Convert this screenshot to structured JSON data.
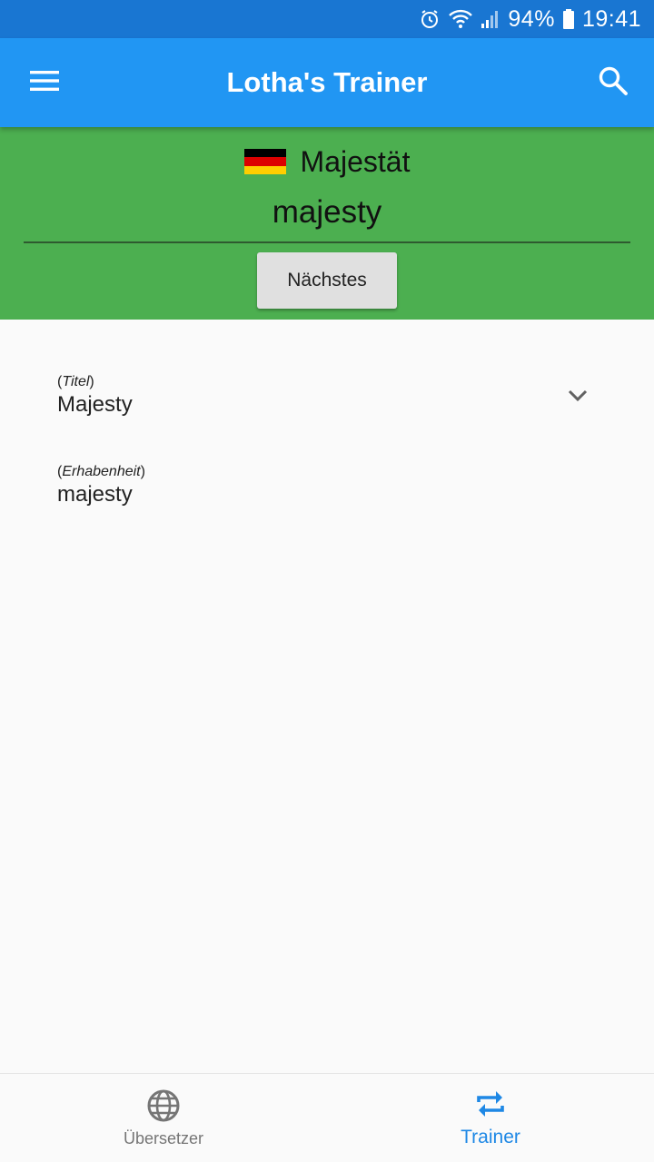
{
  "status_bar": {
    "battery": "94%",
    "time": "19:41",
    "icons": [
      "alarm-icon",
      "wifi-icon",
      "signal-icon",
      "battery-icon"
    ]
  },
  "app_bar": {
    "title": "Lotha's Trainer",
    "menu_icon": "menu-icon",
    "search_icon": "search-icon",
    "color": "#2196f3"
  },
  "quiz": {
    "flag": "germany-flag-icon",
    "source_word": "Majestät",
    "answer": "majesty",
    "next_label": "Nächstes",
    "panel_color": "#4caf50"
  },
  "results": [
    {
      "hint": "Titel",
      "value": "Majesty"
    },
    {
      "hint": "Erhabenheit",
      "value": "majesty"
    }
  ],
  "bottom_nav": {
    "items": [
      {
        "label": "Übersetzer",
        "icon": "globe-icon",
        "active": false
      },
      {
        "label": "Trainer",
        "icon": "repeat-icon",
        "active": true
      }
    ],
    "active_color": "#1e88e5"
  }
}
